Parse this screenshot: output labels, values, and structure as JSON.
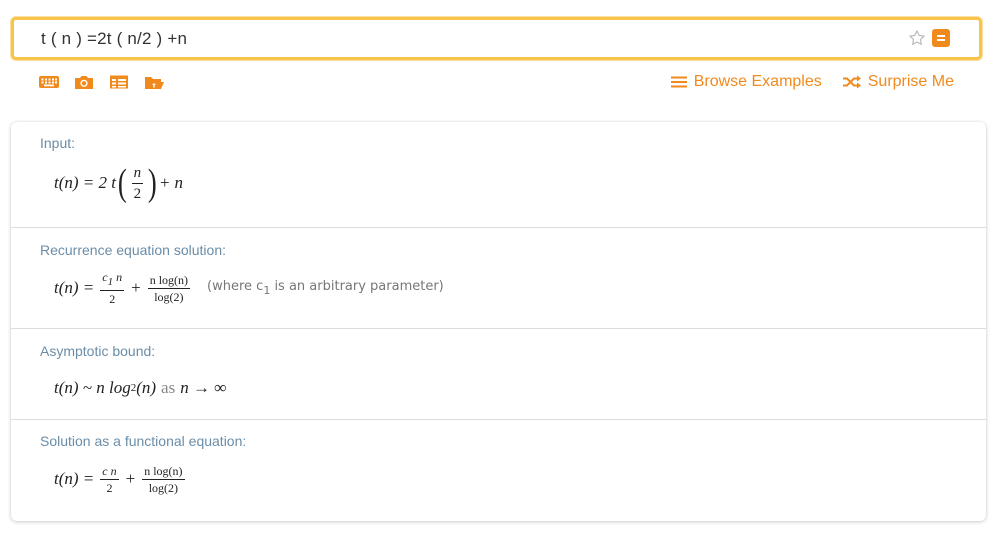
{
  "search": {
    "query": "t ( n ) =2t ( n/2 ) +n"
  },
  "toolbar": {
    "icons": [
      "keyboard-icon",
      "camera-icon",
      "table-icon",
      "folder-icon"
    ],
    "browse_examples": "Browse Examples",
    "surprise_me": "Surprise Me"
  },
  "colors": {
    "accent": "#f18a1d",
    "search_border": "#f8c44a",
    "pod_title": "#6a8da8"
  },
  "pods": [
    {
      "title": "Input:",
      "lhs": "t(n) = 2 t",
      "frac_num": "n",
      "frac_den": "2",
      "rhs": "+ n"
    },
    {
      "title": "Recurrence equation solution:",
      "lhs": "t(n) =",
      "frac1_num": "c",
      "frac1_sub": "1",
      "frac1_num_tail": " n",
      "frac1_den": "2",
      "plus": "+",
      "frac2_num": "n log(n)",
      "frac2_den": "log(2)",
      "note_pre": "(where c",
      "note_sub": "1",
      "note_post": " is an arbitrary parameter)"
    },
    {
      "title": "Asymptotic bound:",
      "expr_pre": "t(n) ~ n log",
      "expr_sub": "2",
      "expr_post": "(n)",
      "as": "as",
      "limit": "n → ∞"
    },
    {
      "title": "Solution as a functional equation:",
      "lhs": "t(n) =",
      "frac1_num": "c n",
      "frac1_den": "2",
      "plus": "+",
      "frac2_num": "n log(n)",
      "frac2_den": "log(2)"
    }
  ]
}
